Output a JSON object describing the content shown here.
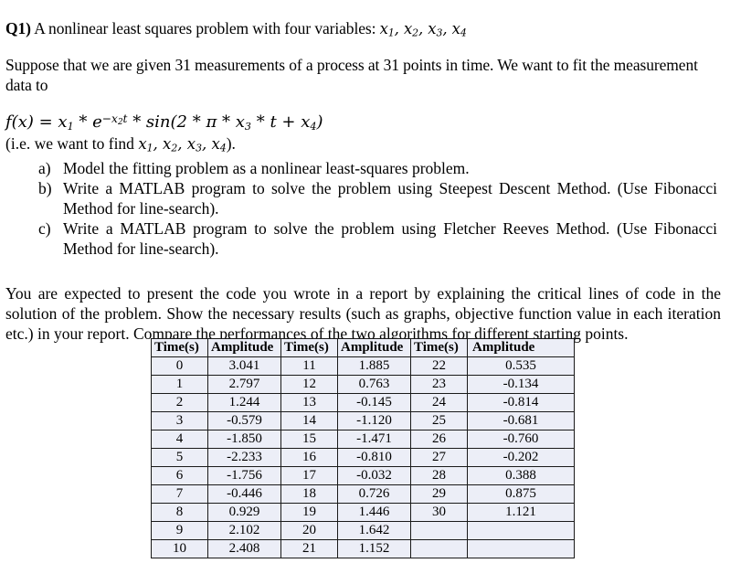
{
  "document": {
    "question_label": "Q1)",
    "title_rest": " A nonlinear least squares problem with four variables: ",
    "title_vars": "x₁, x₂, x₃, x₄",
    "paragraph_1": "Suppose that we are given 31 measurements of a process at 31 points in time. We want to fit the measurement data to",
    "formula": "f(x) = x₁ * e⁻ˣ²ᵗ * sin(2 * π * x₃ * t + x₄)",
    "formula_note": "(i.e. we want to find x₁, x₂, x₃, x₄).",
    "items": [
      {
        "marker": "a)",
        "text": "Model the fitting problem as a nonlinear least-squares problem."
      },
      {
        "marker": "b)",
        "text": "Write a MATLAB program to solve the problem using Steepest Descent Method. (Use Fibonacci Method for line-search)."
      },
      {
        "marker": "c)",
        "text": "Write a MATLAB program to solve the problem using Fletcher Reeves Method. (Use Fibonacci Method for line-search)."
      }
    ],
    "expectation": "You are expected to present the code you wrote in a report by explaining the critical lines of code in the solution of the problem. Show the necessary results (such as graphs, objective function value in each iteration etc.) in your report. Compare the performances of the two algorithms for different starting points."
  },
  "table": {
    "headers": [
      "Time(s)",
      "Amplitude",
      "Time(s)",
      "Amplitude",
      "Time(s)",
      "Amplitude"
    ],
    "rows": [
      [
        "0",
        "3.041",
        "11",
        "1.885",
        "22",
        "0.535"
      ],
      [
        "1",
        "2.797",
        "12",
        "0.763",
        "23",
        "-0.134"
      ],
      [
        "2",
        "1.244",
        "13",
        "-0.145",
        "24",
        "-0.814"
      ],
      [
        "3",
        "-0.579",
        "14",
        "-1.120",
        "25",
        "-0.681"
      ],
      [
        "4",
        "-1.850",
        "15",
        "-1.471",
        "26",
        "-0.760"
      ],
      [
        "5",
        "-2.233",
        "16",
        "-0.810",
        "27",
        "-0.202"
      ],
      [
        "6",
        "-1.756",
        "17",
        "-0.032",
        "28",
        "0.388"
      ],
      [
        "7",
        "-0.446",
        "18",
        "0.726",
        "29",
        "0.875"
      ],
      [
        "8",
        "0.929",
        "19",
        "1.446",
        "30",
        "1.121"
      ],
      [
        "9",
        "2.102",
        "20",
        "1.642",
        "",
        ""
      ],
      [
        "10",
        "2.408",
        "21",
        "1.152",
        "",
        ""
      ]
    ]
  },
  "chart_data": {
    "type": "table",
    "title": "Measurement data: amplitude vs time",
    "xlabel": "Time(s)",
    "ylabel": "Amplitude",
    "x": [
      0,
      1,
      2,
      3,
      4,
      5,
      6,
      7,
      8,
      9,
      10,
      11,
      12,
      13,
      14,
      15,
      16,
      17,
      18,
      19,
      20,
      21,
      22,
      23,
      24,
      25,
      26,
      27,
      28,
      29,
      30
    ],
    "values": [
      3.041,
      2.797,
      1.244,
      -0.579,
      -1.85,
      -2.233,
      -1.756,
      -0.446,
      0.929,
      2.102,
      2.408,
      1.885,
      0.763,
      -0.145,
      -1.12,
      -1.471,
      -0.81,
      -0.032,
      0.726,
      1.446,
      1.642,
      1.152,
      0.535,
      -0.134,
      -0.814,
      -0.681,
      -0.76,
      -0.202,
      0.388,
      0.875,
      1.121
    ]
  },
  "colors": {
    "page_background": "#ffffff",
    "text": "#000000",
    "table_cell_background": "#eceef7",
    "table_border": "#1a1a1a"
  }
}
